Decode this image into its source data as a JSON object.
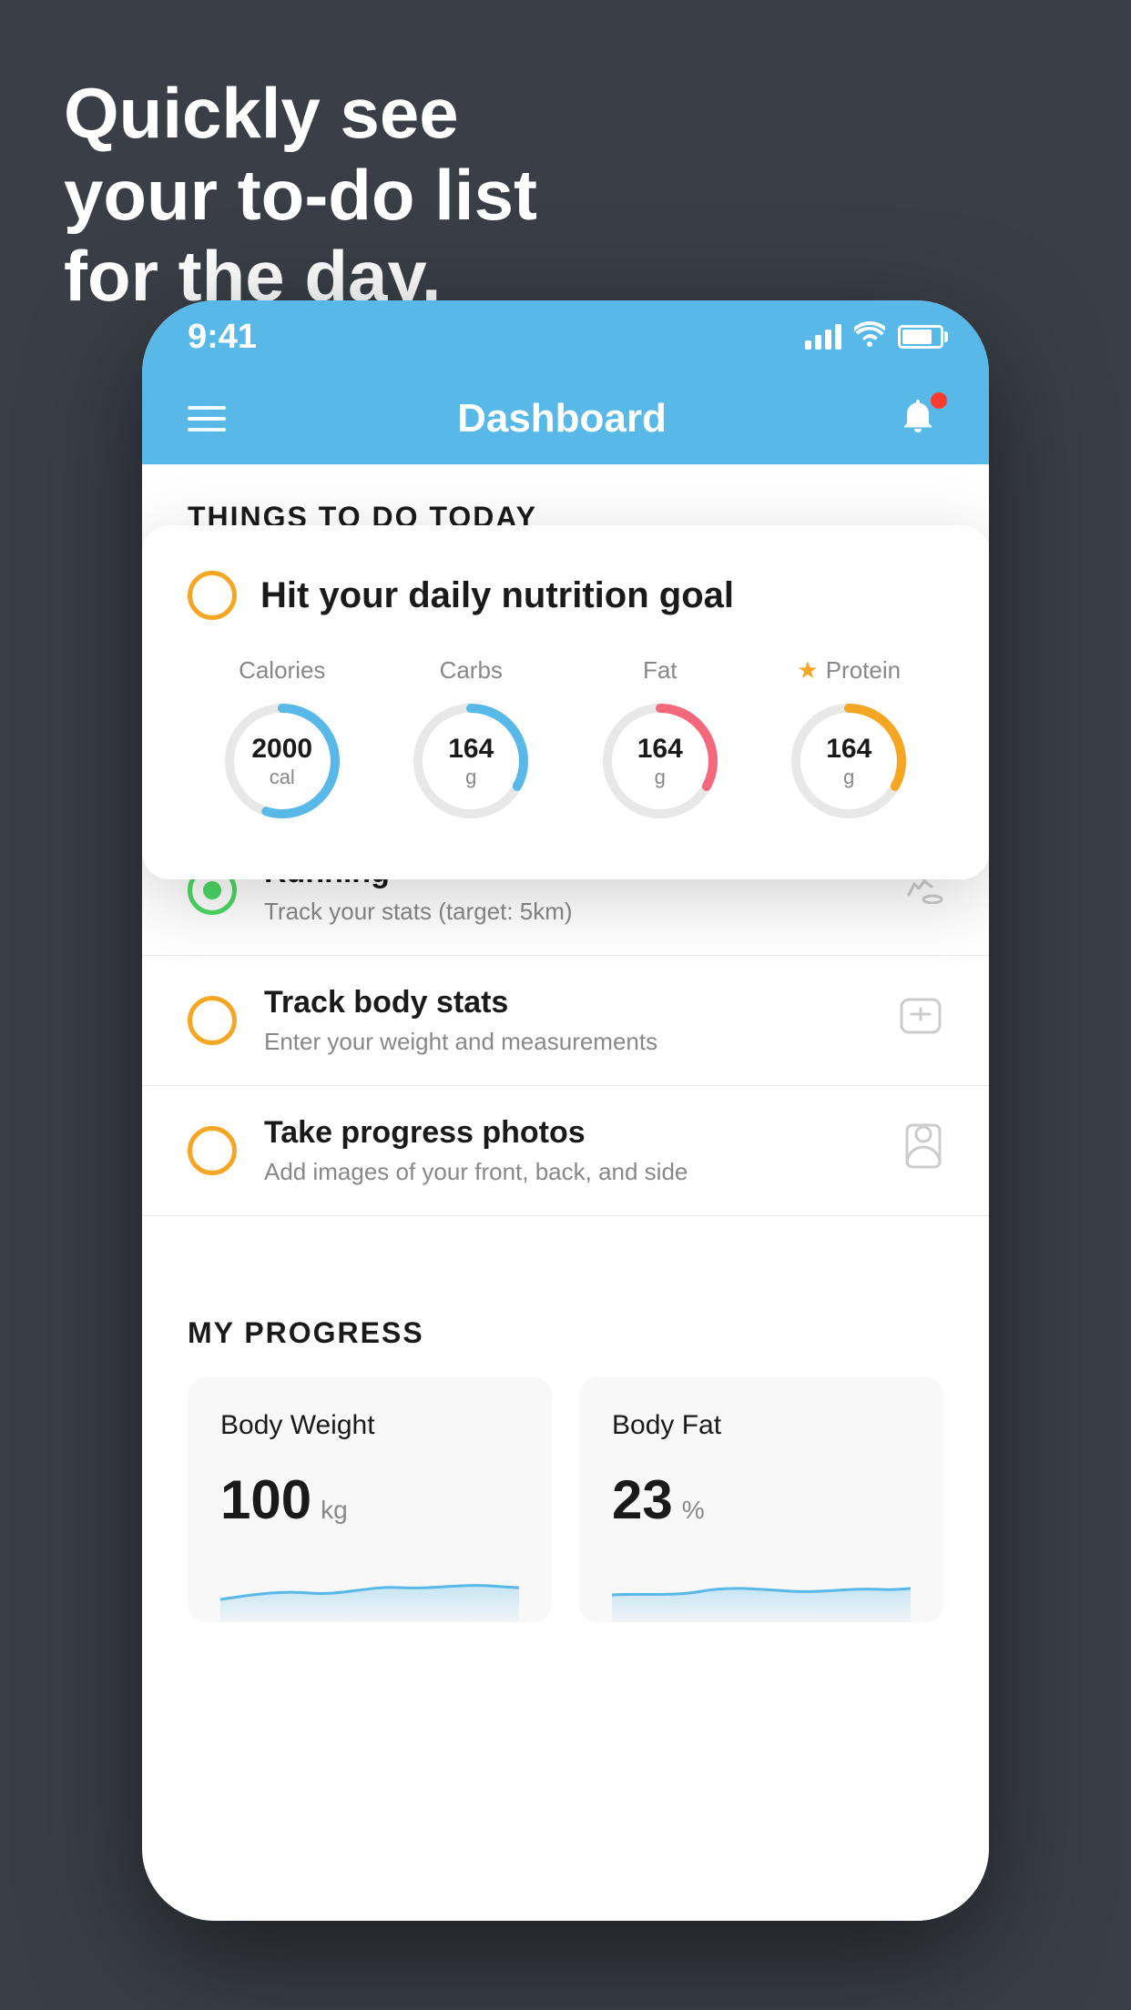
{
  "background": {
    "headline_line1": "Quickly see",
    "headline_line2": "your to-do list",
    "headline_line3": "for the day."
  },
  "status_bar": {
    "time": "9:41"
  },
  "header": {
    "title": "Dashboard"
  },
  "things_section": {
    "label": "THINGS TO DO TODAY"
  },
  "nutrition_card": {
    "circle_check": "yellow",
    "title": "Hit your daily nutrition goal",
    "items": [
      {
        "label": "Calories",
        "value": "2000",
        "unit": "cal",
        "color": "#58b8e8",
        "starred": false
      },
      {
        "label": "Carbs",
        "value": "164",
        "unit": "g",
        "color": "#58b8e8",
        "starred": false
      },
      {
        "label": "Fat",
        "value": "164",
        "unit": "g",
        "color": "#f4687c",
        "starred": false
      },
      {
        "label": "Protein",
        "value": "164",
        "unit": "g",
        "color": "#f5a623",
        "starred": true
      }
    ]
  },
  "todo_items": [
    {
      "name": "Running",
      "desc": "Track your stats (target: 5km)",
      "circle_type": "green",
      "icon": "shoe"
    },
    {
      "name": "Track body stats",
      "desc": "Enter your weight and measurements",
      "circle_type": "yellow",
      "icon": "scale"
    },
    {
      "name": "Take progress photos",
      "desc": "Add images of your front, back, and side",
      "circle_type": "yellow",
      "icon": "person"
    }
  ],
  "progress_section": {
    "title": "MY PROGRESS",
    "cards": [
      {
        "title": "Body Weight",
        "value": "100",
        "unit": "kg"
      },
      {
        "title": "Body Fat",
        "value": "23",
        "unit": "%"
      }
    ]
  }
}
